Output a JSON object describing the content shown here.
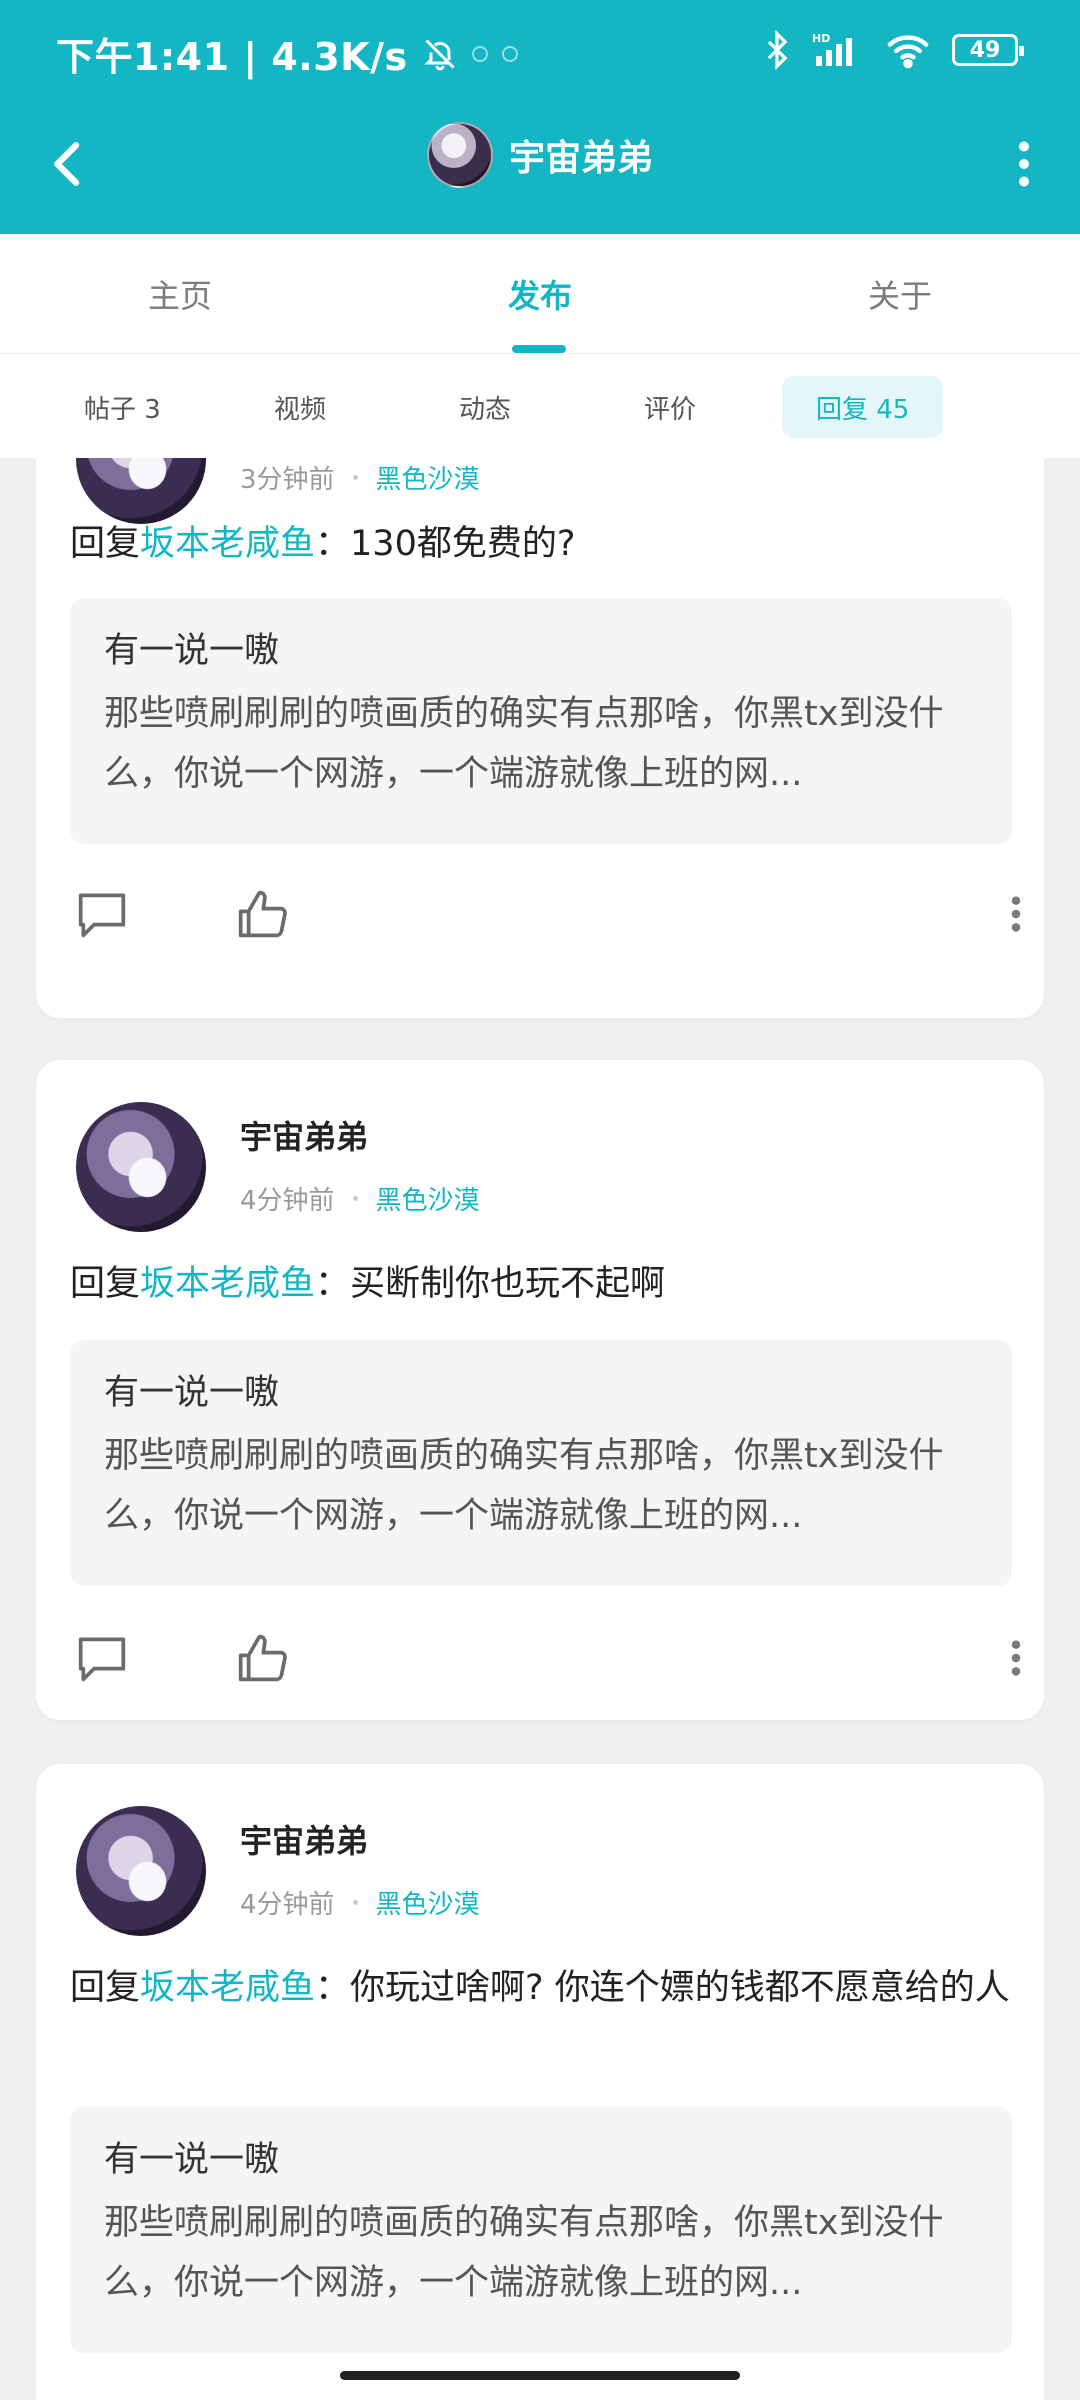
{
  "colors": {
    "accent": "#15b6c3"
  },
  "status_bar": {
    "time_speed": "下午1:41 | 4.3K/s",
    "battery": "49",
    "icons": [
      "bell-off-icon",
      "bluetooth-icon",
      "hd-signal-icon",
      "wifi-icon",
      "battery-icon"
    ]
  },
  "header": {
    "title": "宇宙弟弟",
    "back_icon": "chevron-left-icon",
    "more_icon": "more-vertical-icon"
  },
  "tabs": [
    {
      "label": "主页"
    },
    {
      "label": "发布"
    },
    {
      "label": "关于"
    }
  ],
  "subtabs": [
    {
      "label": "帖子 3"
    },
    {
      "label": "视频"
    },
    {
      "label": "动态"
    },
    {
      "label": "评价"
    },
    {
      "label": "回复 45"
    }
  ],
  "posts": [
    {
      "time": "3分钟前",
      "game": "黑色沙漠",
      "reply_prefix": "回复",
      "mention": "坂本老咸鱼",
      "reply_text": "：130都免费的?",
      "quote_title": "有一说一嗷",
      "quote_body": "那些喷刷刷刷的喷画质的确实有点那啥，你黑tx到没什么，你说一个网游，一个端游就像上班的网..."
    },
    {
      "name": "宇宙弟弟",
      "time": "4分钟前",
      "game": "黑色沙漠",
      "reply_prefix": "回复",
      "mention": "坂本老咸鱼",
      "reply_text": "：买断制你也玩不起啊",
      "quote_title": "有一说一嗷",
      "quote_body": "那些喷刷刷刷的喷画质的确实有点那啥，你黑tx到没什么，你说一个网游，一个端游就像上班的网..."
    },
    {
      "name": "宇宙弟弟",
      "time": "4分钟前",
      "game": "黑色沙漠",
      "reply_prefix": "回复",
      "mention": "坂本老咸鱼",
      "reply_text": "：你玩过啥啊? 你连个嫖的钱都不愿意给的人",
      "quote_title": "有一说一嗷",
      "quote_body": "那些喷刷刷刷的喷画质的确实有点那啥，你黑tx到没什么，你说一个网游，一个端游就像上班的网..."
    }
  ]
}
